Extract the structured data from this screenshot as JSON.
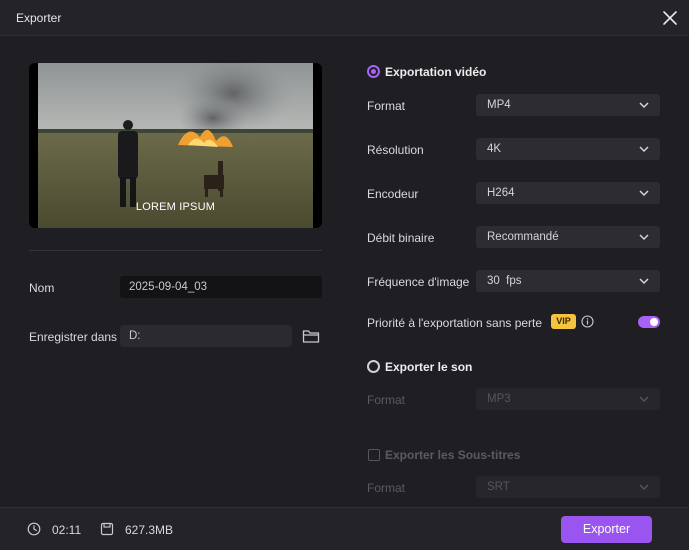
{
  "window": {
    "title": "Exporter"
  },
  "preview": {
    "caption": "LOREM IPSUM"
  },
  "name": {
    "label": "Nom",
    "value": "2025-09-04_03"
  },
  "save": {
    "label": "Enregistrer dans",
    "value": "D:"
  },
  "video": {
    "title": "Exportation vidéo",
    "format": {
      "label": "Format",
      "value": "MP4"
    },
    "resolution": {
      "label": "Résolution",
      "value": "4K"
    },
    "encoder": {
      "label": "Encodeur",
      "value": "H264"
    },
    "bitrate": {
      "label": "Débit binaire",
      "value": "Recommandé"
    },
    "framerate": {
      "label": "Fréquence d'image",
      "value": "30  fps"
    },
    "priority": {
      "label": "Priorité à l'exportation sans perte",
      "badge": "VIP",
      "enabled": true
    }
  },
  "audio": {
    "title": "Exporter le son",
    "format": {
      "label": "Format",
      "value": "MP3"
    }
  },
  "subtitles": {
    "title": "Exporter les Sous-titres",
    "format": {
      "label": "Format",
      "value": "SRT"
    }
  },
  "footer": {
    "duration": "02:11",
    "size": "627.3MB",
    "export_label": "Exporter"
  },
  "colors": {
    "accent": "#a763f5",
    "button": "#9a55f0",
    "vip": "#f5c242",
    "background": "#1f1f23"
  },
  "icons": [
    "close-icon",
    "folder-icon",
    "chevron-down-icon",
    "info-icon",
    "clock-icon",
    "save-icon"
  ]
}
